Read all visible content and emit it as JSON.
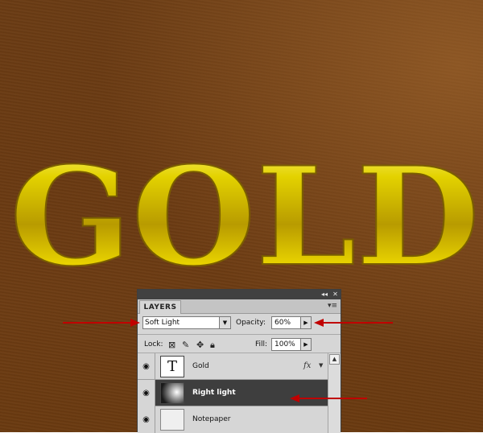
{
  "canvas": {
    "text": "GOLD",
    "background_color": "#6b3c14",
    "text_color": "#e6d000"
  },
  "panel": {
    "tab_label": "LAYERS",
    "collapse_icon": "double-arrow-right-icon",
    "close_icon": "close-icon",
    "menu_icon": "panel-menu-icon",
    "blend_mode": "Soft Light",
    "opacity_label": "Opacity:",
    "opacity_value": "60%",
    "lock_label": "Lock:",
    "fill_label": "Fill:",
    "fill_value": "100%",
    "layers": [
      {
        "name": "Gold",
        "thumb": "T",
        "fx": "fx",
        "selected": false
      },
      {
        "name": "Right light",
        "selected": true
      },
      {
        "name": "Notepaper",
        "selected": false
      }
    ]
  },
  "annotations": {
    "arrow_color": "#c00000"
  }
}
